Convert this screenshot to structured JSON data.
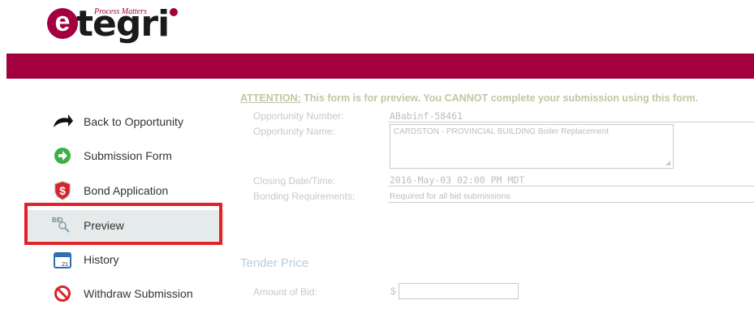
{
  "logo": {
    "letter": "e",
    "word": "tegri",
    "tagline": "Process Matters"
  },
  "nav": {
    "items": [
      {
        "label": "Back to Opportunity",
        "icon": "back-arrow-icon"
      },
      {
        "label": "Submission Form",
        "icon": "green-arrow-icon"
      },
      {
        "label": "Bond Application",
        "icon": "dollar-shield-icon"
      },
      {
        "label": "Preview",
        "icon": "bid-magnifier-icon",
        "icon_text": "BID",
        "active": true
      },
      {
        "label": "History",
        "icon": "calendar-icon",
        "icon_text": "21"
      },
      {
        "label": "Withdraw Submission",
        "icon": "no-entry-icon"
      }
    ]
  },
  "form": {
    "attention_prefix": "ATTENTION:",
    "attention_text": " This form is for preview. You CANNOT complete your submission using this form.",
    "opportunity_number_label": "Opportunity Number:",
    "opportunity_number": "ABabinf-58461",
    "opportunity_name_label": "Opportunity Name:",
    "opportunity_name": "CARDSTON - PROVINCIAL BUILDING Boiler Replacement",
    "closing_label": "Closing Date/Time:",
    "closing_value": "2016-May-03 02:00 PM MDT",
    "bonding_label": "Bonding Requirements:",
    "bonding_value": "Required  for all bid submissions",
    "tender_section": "Tender Price",
    "amount_label": "Amount of Bid:",
    "currency": "$",
    "amount_value": ""
  },
  "colors": {
    "brand": "#a3003f",
    "highlight": "#e52027"
  }
}
